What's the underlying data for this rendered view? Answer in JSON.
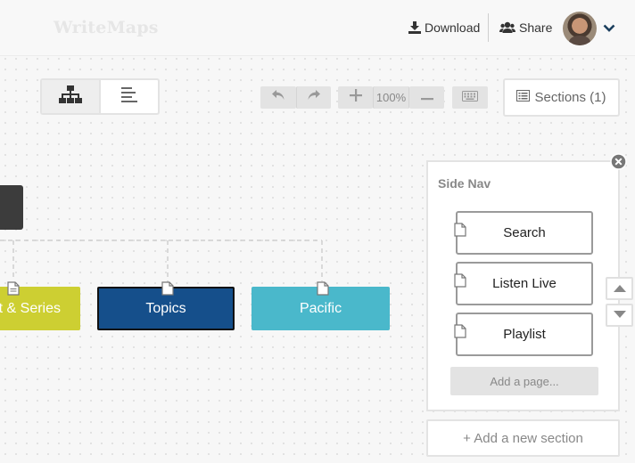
{
  "header": {
    "logo": "WriteMaps",
    "download_label": "Download",
    "share_label": "Share"
  },
  "toolbar": {
    "zoom_label": "100%",
    "sections_label": "Sections (1)"
  },
  "canvas": {
    "nodes": [
      {
        "label": "st & Series",
        "color": "#cdcf32"
      },
      {
        "label": "Topics",
        "color": "#154f8b"
      },
      {
        "label": "Pacific",
        "color": "#4ab8cb"
      }
    ]
  },
  "side_nav": {
    "title": "Side Nav",
    "items": [
      {
        "label": "Search"
      },
      {
        "label": "Listen Live"
      },
      {
        "label": "Playlist"
      }
    ],
    "add_page_label": "Add a page..."
  },
  "add_section_label": "+ Add a new section",
  "icons": {
    "download": "download-icon",
    "share": "users-icon",
    "menu": "chevron-down-icon",
    "sitemap": "sitemap-icon",
    "list": "list-icon",
    "undo": "undo-icon",
    "redo": "redo-icon",
    "zoom_in": "plus-icon",
    "zoom_out": "minus-icon",
    "keyboard": "keyboard-icon",
    "page": "page-icon",
    "close": "close-icon",
    "up": "caret-up-icon",
    "down": "caret-down-icon"
  }
}
